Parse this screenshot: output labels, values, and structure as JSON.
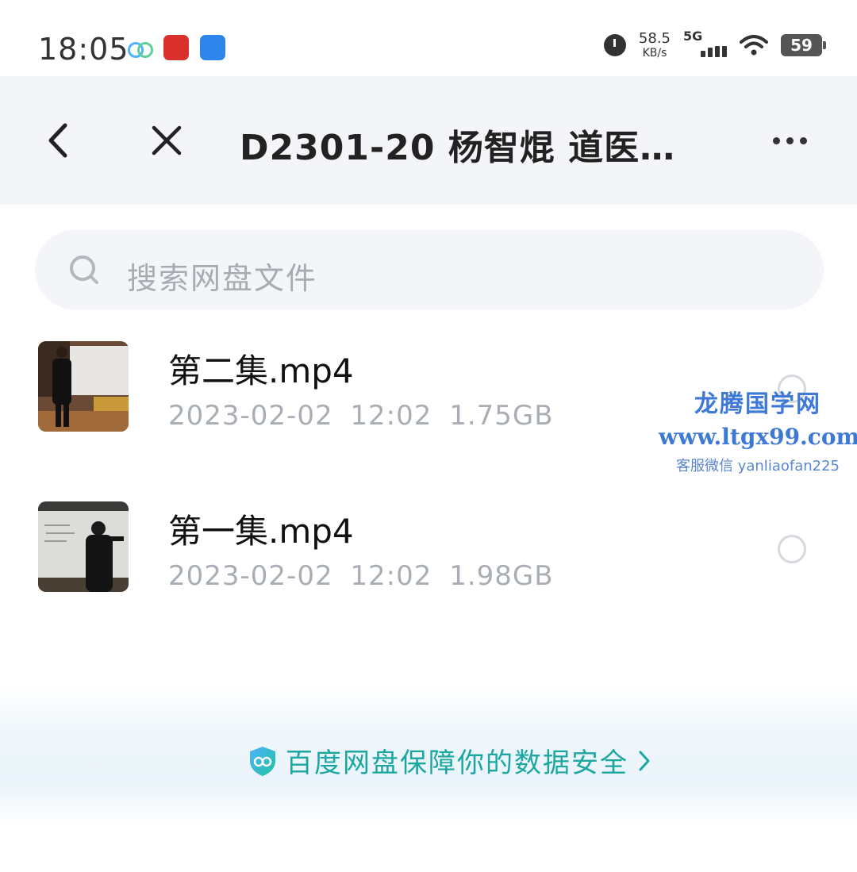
{
  "status_bar": {
    "time": "18:05",
    "net_speed_value": "58.5",
    "net_speed_unit": "KB/s",
    "network_type": "5G",
    "battery": "59",
    "icons": [
      "baidu-netdisk-icon",
      "red-app-icon",
      "blue-app-icon",
      "alarm-icon",
      "signal-icon",
      "wifi-icon",
      "battery-icon"
    ]
  },
  "header": {
    "title": "D2301-20 杨智焜  道医…",
    "back_icon": "chevron-left-icon",
    "close_icon": "close-icon",
    "more_icon": "more-icon"
  },
  "search": {
    "placeholder": "搜索网盘文件",
    "icon": "search-icon"
  },
  "files": [
    {
      "name": "第二集.mp4",
      "meta": "2023-02-02  12:02  1.75GB"
    },
    {
      "name": "第一集.mp4",
      "meta": "2023-02-02  12:02  1.98GB"
    }
  ],
  "watermark": {
    "title": "龙腾国学网",
    "url": "www.ltgx99.com",
    "contact": "客服微信 yanliaofan225"
  },
  "footer": {
    "security_text": "百度网盘保障你的数据安全",
    "accent_color": "#1ba7a0"
  }
}
